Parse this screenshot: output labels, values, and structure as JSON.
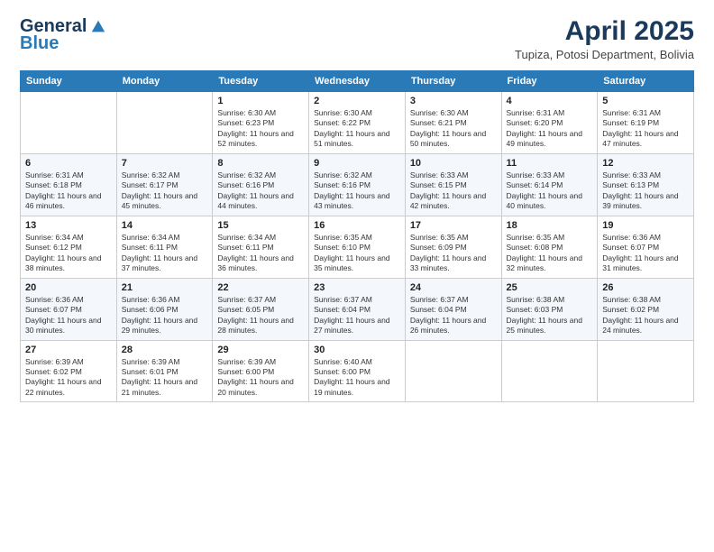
{
  "header": {
    "logo_general": "General",
    "logo_blue": "Blue",
    "month": "April 2025",
    "location": "Tupiza, Potosi Department, Bolivia"
  },
  "days_of_week": [
    "Sunday",
    "Monday",
    "Tuesday",
    "Wednesday",
    "Thursday",
    "Friday",
    "Saturday"
  ],
  "weeks": [
    [
      {
        "day": "",
        "sunrise": "",
        "sunset": "",
        "daylight": ""
      },
      {
        "day": "",
        "sunrise": "",
        "sunset": "",
        "daylight": ""
      },
      {
        "day": "1",
        "sunrise": "Sunrise: 6:30 AM",
        "sunset": "Sunset: 6:23 PM",
        "daylight": "Daylight: 11 hours and 52 minutes."
      },
      {
        "day": "2",
        "sunrise": "Sunrise: 6:30 AM",
        "sunset": "Sunset: 6:22 PM",
        "daylight": "Daylight: 11 hours and 51 minutes."
      },
      {
        "day": "3",
        "sunrise": "Sunrise: 6:30 AM",
        "sunset": "Sunset: 6:21 PM",
        "daylight": "Daylight: 11 hours and 50 minutes."
      },
      {
        "day": "4",
        "sunrise": "Sunrise: 6:31 AM",
        "sunset": "Sunset: 6:20 PM",
        "daylight": "Daylight: 11 hours and 49 minutes."
      },
      {
        "day": "5",
        "sunrise": "Sunrise: 6:31 AM",
        "sunset": "Sunset: 6:19 PM",
        "daylight": "Daylight: 11 hours and 47 minutes."
      }
    ],
    [
      {
        "day": "6",
        "sunrise": "Sunrise: 6:31 AM",
        "sunset": "Sunset: 6:18 PM",
        "daylight": "Daylight: 11 hours and 46 minutes."
      },
      {
        "day": "7",
        "sunrise": "Sunrise: 6:32 AM",
        "sunset": "Sunset: 6:17 PM",
        "daylight": "Daylight: 11 hours and 45 minutes."
      },
      {
        "day": "8",
        "sunrise": "Sunrise: 6:32 AM",
        "sunset": "Sunset: 6:16 PM",
        "daylight": "Daylight: 11 hours and 44 minutes."
      },
      {
        "day": "9",
        "sunrise": "Sunrise: 6:32 AM",
        "sunset": "Sunset: 6:16 PM",
        "daylight": "Daylight: 11 hours and 43 minutes."
      },
      {
        "day": "10",
        "sunrise": "Sunrise: 6:33 AM",
        "sunset": "Sunset: 6:15 PM",
        "daylight": "Daylight: 11 hours and 42 minutes."
      },
      {
        "day": "11",
        "sunrise": "Sunrise: 6:33 AM",
        "sunset": "Sunset: 6:14 PM",
        "daylight": "Daylight: 11 hours and 40 minutes."
      },
      {
        "day": "12",
        "sunrise": "Sunrise: 6:33 AM",
        "sunset": "Sunset: 6:13 PM",
        "daylight": "Daylight: 11 hours and 39 minutes."
      }
    ],
    [
      {
        "day": "13",
        "sunrise": "Sunrise: 6:34 AM",
        "sunset": "Sunset: 6:12 PM",
        "daylight": "Daylight: 11 hours and 38 minutes."
      },
      {
        "day": "14",
        "sunrise": "Sunrise: 6:34 AM",
        "sunset": "Sunset: 6:11 PM",
        "daylight": "Daylight: 11 hours and 37 minutes."
      },
      {
        "day": "15",
        "sunrise": "Sunrise: 6:34 AM",
        "sunset": "Sunset: 6:11 PM",
        "daylight": "Daylight: 11 hours and 36 minutes."
      },
      {
        "day": "16",
        "sunrise": "Sunrise: 6:35 AM",
        "sunset": "Sunset: 6:10 PM",
        "daylight": "Daylight: 11 hours and 35 minutes."
      },
      {
        "day": "17",
        "sunrise": "Sunrise: 6:35 AM",
        "sunset": "Sunset: 6:09 PM",
        "daylight": "Daylight: 11 hours and 33 minutes."
      },
      {
        "day": "18",
        "sunrise": "Sunrise: 6:35 AM",
        "sunset": "Sunset: 6:08 PM",
        "daylight": "Daylight: 11 hours and 32 minutes."
      },
      {
        "day": "19",
        "sunrise": "Sunrise: 6:36 AM",
        "sunset": "Sunset: 6:07 PM",
        "daylight": "Daylight: 11 hours and 31 minutes."
      }
    ],
    [
      {
        "day": "20",
        "sunrise": "Sunrise: 6:36 AM",
        "sunset": "Sunset: 6:07 PM",
        "daylight": "Daylight: 11 hours and 30 minutes."
      },
      {
        "day": "21",
        "sunrise": "Sunrise: 6:36 AM",
        "sunset": "Sunset: 6:06 PM",
        "daylight": "Daylight: 11 hours and 29 minutes."
      },
      {
        "day": "22",
        "sunrise": "Sunrise: 6:37 AM",
        "sunset": "Sunset: 6:05 PM",
        "daylight": "Daylight: 11 hours and 28 minutes."
      },
      {
        "day": "23",
        "sunrise": "Sunrise: 6:37 AM",
        "sunset": "Sunset: 6:04 PM",
        "daylight": "Daylight: 11 hours and 27 minutes."
      },
      {
        "day": "24",
        "sunrise": "Sunrise: 6:37 AM",
        "sunset": "Sunset: 6:04 PM",
        "daylight": "Daylight: 11 hours and 26 minutes."
      },
      {
        "day": "25",
        "sunrise": "Sunrise: 6:38 AM",
        "sunset": "Sunset: 6:03 PM",
        "daylight": "Daylight: 11 hours and 25 minutes."
      },
      {
        "day": "26",
        "sunrise": "Sunrise: 6:38 AM",
        "sunset": "Sunset: 6:02 PM",
        "daylight": "Daylight: 11 hours and 24 minutes."
      }
    ],
    [
      {
        "day": "27",
        "sunrise": "Sunrise: 6:39 AM",
        "sunset": "Sunset: 6:02 PM",
        "daylight": "Daylight: 11 hours and 22 minutes."
      },
      {
        "day": "28",
        "sunrise": "Sunrise: 6:39 AM",
        "sunset": "Sunset: 6:01 PM",
        "daylight": "Daylight: 11 hours and 21 minutes."
      },
      {
        "day": "29",
        "sunrise": "Sunrise: 6:39 AM",
        "sunset": "Sunset: 6:00 PM",
        "daylight": "Daylight: 11 hours and 20 minutes."
      },
      {
        "day": "30",
        "sunrise": "Sunrise: 6:40 AM",
        "sunset": "Sunset: 6:00 PM",
        "daylight": "Daylight: 11 hours and 19 minutes."
      },
      {
        "day": "",
        "sunrise": "",
        "sunset": "",
        "daylight": ""
      },
      {
        "day": "",
        "sunrise": "",
        "sunset": "",
        "daylight": ""
      },
      {
        "day": "",
        "sunrise": "",
        "sunset": "",
        "daylight": ""
      }
    ]
  ]
}
